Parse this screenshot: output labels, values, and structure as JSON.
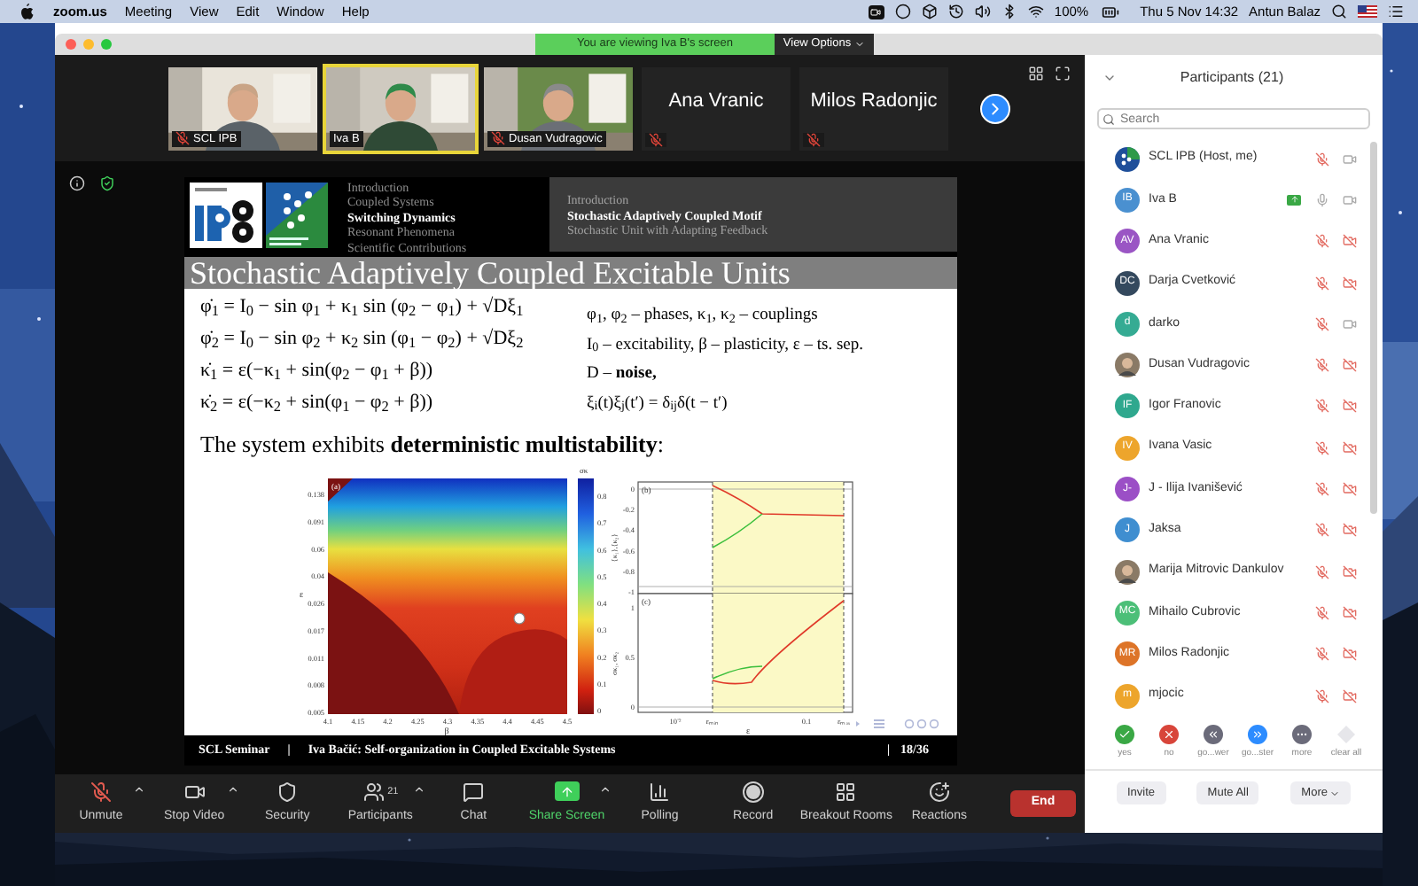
{
  "menu_bar": {
    "app": "zoom.us",
    "menus": [
      "Meeting",
      "View",
      "Edit",
      "Window",
      "Help"
    ],
    "battery": "100%",
    "clock": "Thu 5 Nov  14:32",
    "user": "Antun Balaz"
  },
  "window": {
    "banner": "You are viewing Iva B's screen",
    "view_options": "View Options"
  },
  "videos": [
    {
      "name": "SCL IPB",
      "kind": "video",
      "muted": true,
      "speaking": false
    },
    {
      "name": "Iva B",
      "kind": "video",
      "muted": false,
      "speaking": true
    },
    {
      "name": "Dusan Vudragovic",
      "kind": "video",
      "muted": true,
      "speaking": false
    },
    {
      "name": "Ana Vranic",
      "kind": "name",
      "muted": true,
      "speaking": false
    },
    {
      "name": "Milos Radonjic",
      "kind": "name",
      "muted": true,
      "speaking": false
    }
  ],
  "slide": {
    "nav_left": [
      {
        "label": "Introduction",
        "selected": false
      },
      {
        "label": "Coupled Systems",
        "selected": false
      },
      {
        "label": "Switching Dynamics",
        "selected": true
      },
      {
        "label": "Resonant Phenomena",
        "selected": false
      },
      {
        "label": "Scientific Contributions",
        "selected": false
      }
    ],
    "nav_right": [
      {
        "label": "Introduction",
        "selected": false
      },
      {
        "label": "Stochastic Adaptively Coupled Motif",
        "selected": true
      },
      {
        "label": "Stochastic Unit with Adapting Feedback",
        "selected": false
      }
    ],
    "title": "Stochastic Adaptively Coupled Excitable Units",
    "equations": [
      "φ̇$_{1}$ = I$_{0}$ − sin φ$_{1}$ + κ$_{1}$ sin (φ$_{2}$ − φ$_{1}$) + √Dξ$_{1}$",
      "φ̇$_{2}$ = I$_{0}$ − sin φ$_{2}$ + κ$_{2}$ sin (φ$_{1}$ − φ$_{2}$) + √Dξ$_{2}$",
      "κ̇$_{1}$ = ε(−κ$_{1}$ + sin(φ$_{2}$ − φ$_{1}$ + β))",
      "κ̇$_{2}$ = ε(−κ$_{2}$ + sin(φ$_{1}$ − φ$_{2}$ + β))"
    ],
    "legend": [
      "φ$_{1}$, φ$_{2}$ – phases, κ$_{1}$, κ$_{2}$ – couplings",
      "I$_{0}$ – excitability, β – plasticity, ε – ts. sep.",
      "D – **noise,**",
      "ξ$_{i}$(t)ξ$_{j}$(t′) = δ$_{ij}$δ(t − t′)"
    ],
    "sentence": "The system exhibits **deterministic multistability**:",
    "figure": {
      "heatmap": {
        "panel": "(a)",
        "x_ticks": [
          "4.1",
          "4.15",
          "4.2",
          "4.25",
          "4.3",
          "4.35",
          "4.4",
          "4.45",
          "4.5"
        ],
        "x_label": "β",
        "y_ticks": [
          "0.138",
          "0.091",
          "0.06",
          "0.04",
          "0.026",
          "0.017",
          "0.011",
          "0.008",
          "0.005"
        ],
        "y_label": "ε",
        "colorbar_ticks": [
          "0.8",
          "0.7",
          "0.6",
          "0.5",
          "0.4",
          "0.3",
          "0.2",
          "0.1",
          "0"
        ],
        "colorbar_label": "σκ"
      },
      "plots": {
        "x_ticks": [
          "10⁻²",
          "εₘᵢₙ",
          "0.1",
          "εₘₐₓ"
        ],
        "x_label": "ε",
        "top": {
          "panel": "(b)",
          "y_label": "⟨κ₁⟩,⟨κ₂⟩",
          "y_ticks": [
            "0",
            "-0.2",
            "-0.4",
            "-0.6",
            "-0.8",
            "-1"
          ]
        },
        "bottom": {
          "panel": "(c)",
          "y_label": "σκ₁, σκ₂",
          "y_ticks": [
            "1",
            "0.5",
            "0"
          ]
        }
      }
    },
    "footer": [
      "SCL Seminar",
      "|",
      "Iva Bačić:  Self-organization in Coupled Excitable Systems",
      "|",
      "18/36"
    ]
  },
  "toolbar": [
    {
      "label": "Unmute",
      "kind": "mic-off",
      "caret": true
    },
    {
      "label": "Stop Video",
      "kind": "video",
      "caret": true
    },
    {
      "label": "Security",
      "kind": "security",
      "caret": false
    },
    {
      "label": "Participants",
      "kind": "participants",
      "caret": true,
      "count": "21"
    },
    {
      "label": "Chat",
      "kind": "chat",
      "caret": false
    },
    {
      "label": "Share Screen",
      "kind": "share",
      "caret": true
    },
    {
      "label": "Polling",
      "kind": "polling",
      "caret": false
    },
    {
      "label": "Record",
      "kind": "record",
      "caret": false
    },
    {
      "label": "Breakout Rooms",
      "kind": "breakout",
      "caret": false
    },
    {
      "label": "Reactions",
      "kind": "reactions",
      "caret": false
    }
  ],
  "end_button": "End",
  "participants": {
    "title": "Participants (21)",
    "search_placeholder": "Search",
    "people": [
      {
        "name": "SCL IPB (Host, me)",
        "kind": "logo",
        "muted": true,
        "video_on": true,
        "sharing": false
      },
      {
        "name": "Iva B",
        "kind": "initials",
        "initials": "IB",
        "color": "#4a90d0",
        "muted": false,
        "video_on": true,
        "sharing": true
      },
      {
        "name": "Ana Vranic",
        "kind": "initials",
        "initials": "AV",
        "color": "#9a55c4",
        "muted": true,
        "video_on": false,
        "sharing": false
      },
      {
        "name": "Darja Cvetković",
        "kind": "initials",
        "initials": "DC",
        "color": "#34495e",
        "muted": true,
        "video_on": false,
        "sharing": false
      },
      {
        "name": "darko",
        "kind": "initials",
        "initials": "d",
        "color": "#35ab93",
        "muted": true,
        "video_on": true,
        "sharing": false
      },
      {
        "name": "Dusan Vudragovic",
        "muted": true,
        "video_on": false,
        "sharing": false
      },
      {
        "name": "Igor Franovic",
        "kind": "initials",
        "initials": "IF",
        "color": "#2fa88e",
        "muted": true,
        "video_on": false,
        "sharing": false
      },
      {
        "name": "Ivana Vasic",
        "kind": "initials",
        "initials": "IV",
        "color": "#eda52c",
        "muted": true,
        "video_on": false,
        "sharing": false
      },
      {
        "name": "J - Ilija Ivanišević",
        "kind": "initials",
        "initials": "J-",
        "color": "#9b4fc6",
        "muted": true,
        "video_on": false,
        "sharing": false
      },
      {
        "name": "Jaksa",
        "kind": "initials",
        "initials": "J",
        "color": "#3f8ed0",
        "muted": true,
        "video_on": false,
        "sharing": false
      },
      {
        "name": "Marija Mitrovic Dankulov",
        "muted": true,
        "video_on": false,
        "sharing": false
      },
      {
        "name": "Mihailo Cubrovic",
        "kind": "initials",
        "initials": "MC",
        "color": "#4cbf78",
        "muted": true,
        "video_on": false,
        "sharing": false
      },
      {
        "name": "Milos Radonjic",
        "kind": "initials",
        "initials": "MR",
        "color": "#dd7428",
        "muted": true,
        "video_on": false,
        "sharing": false
      },
      {
        "name": "mjocic",
        "kind": "initials",
        "initials": "m",
        "color": "#eda52c",
        "muted": true,
        "video_on": false,
        "sharing": false
      }
    ],
    "reactions": [
      {
        "label": "yes",
        "kind": "yes"
      },
      {
        "label": "no",
        "kind": "no"
      },
      {
        "label": "go...wer",
        "kind": "slower"
      },
      {
        "label": "go...ster",
        "kind": "faster"
      },
      {
        "label": "more",
        "kind": "more"
      },
      {
        "label": "clear all",
        "kind": "clear"
      }
    ],
    "buttons": [
      {
        "label": "Invite",
        "kind": "plain"
      },
      {
        "label": "Mute All",
        "kind": "plain"
      },
      {
        "label": "More",
        "kind": "menu"
      }
    ]
  }
}
